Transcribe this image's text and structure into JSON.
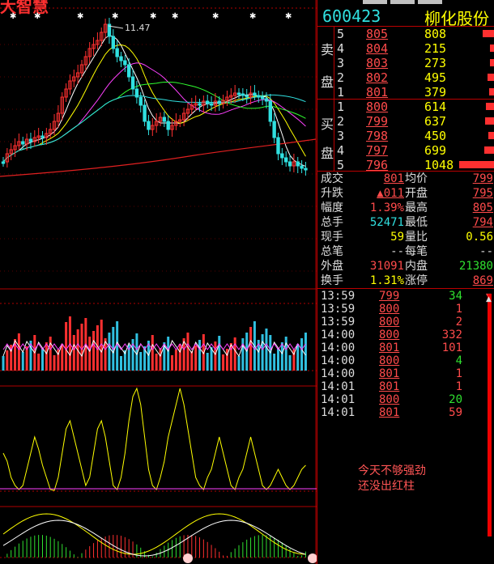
{
  "stock": {
    "code": "600423",
    "name": "柳化股份"
  },
  "window_title_fragment": "大智慧",
  "chart": {
    "high_label": "11.47"
  },
  "order_book": {
    "sell_side_label": [
      "卖",
      "盘"
    ],
    "buy_side_label": [
      "买",
      "盘"
    ],
    "sell": [
      {
        "level": "5",
        "price": "805",
        "volume": "808",
        "bar": 0.35
      },
      {
        "level": "4",
        "price": "804",
        "volume": "215",
        "bar": 0.1
      },
      {
        "level": "3",
        "price": "803",
        "volume": "273",
        "bar": 0.12
      },
      {
        "level": "2",
        "price": "802",
        "volume": "495",
        "bar": 0.2
      },
      {
        "level": "1",
        "price": "801",
        "volume": "379",
        "bar": 0.16
      }
    ],
    "buy": [
      {
        "level": "1",
        "price": "800",
        "volume": "614",
        "bar": 0.26
      },
      {
        "level": "2",
        "price": "799",
        "volume": "637",
        "bar": 0.27
      },
      {
        "level": "3",
        "price": "798",
        "volume": "450",
        "bar": 0.19
      },
      {
        "level": "4",
        "price": "797",
        "volume": "699",
        "bar": 0.3
      },
      {
        "level": "5",
        "price": "796",
        "volume": "1048",
        "bar": 1.0
      }
    ]
  },
  "stats": [
    {
      "l1": "成交",
      "v1": "801",
      "c1": "#ff4b4b",
      "u1": true,
      "l2": "均价",
      "v2": "799",
      "c2": "#ff4b4b",
      "u2": true
    },
    {
      "l1": "升跌",
      "v1": "▲011",
      "c1": "#ff4b4b",
      "u1": true,
      "l2": "开盘",
      "v2": "795",
      "c2": "#ff4b4b",
      "u2": true
    },
    {
      "l1": "幅度",
      "v1": "1.39%",
      "c1": "#ff4b4b",
      "u1": false,
      "l2": "最高",
      "v2": "805",
      "c2": "#ff4b4b",
      "u2": true
    },
    {
      "l1": "总手",
      "v1": "52471",
      "c1": "#30e0e0",
      "u1": false,
      "l2": "最低",
      "v2": "794",
      "c2": "#ff4b4b",
      "u2": true
    },
    {
      "l1": "现手",
      "v1": "59",
      "c1": "#ffff00",
      "u1": false,
      "l2": "量比",
      "v2": "0.56",
      "c2": "#ffff00",
      "u2": false
    },
    {
      "l1": "总笔",
      "v1": "--",
      "c1": "#ddd",
      "u1": false,
      "l2": "每笔",
      "v2": "--",
      "c2": "#ddd",
      "u2": false
    },
    {
      "l1": "外盘",
      "v1": "31091",
      "c1": "#ff4b4b",
      "u1": false,
      "l2": "内盘",
      "v2": "21380",
      "c2": "#30e030",
      "u2": false
    },
    {
      "l1": "换手",
      "v1": "1.31%",
      "c1": "#ffff00",
      "u1": false,
      "l2": "涨停",
      "v2": "869",
      "c2": "#ff4b4b",
      "u2": true
    }
  ],
  "ticks": [
    {
      "time": "13:59",
      "price": "799",
      "vol": "34",
      "color": "#30e030",
      "arrow": "▼"
    },
    {
      "time": "13:59",
      "price": "800",
      "vol": "1",
      "color": "#ff4b4b",
      "arrow": ""
    },
    {
      "time": "13:59",
      "price": "800",
      "vol": "2",
      "color": "#ff4b4b",
      "arrow": ""
    },
    {
      "time": "14:00",
      "price": "800",
      "vol": "332",
      "color": "#ff4b4b",
      "arrow": ""
    },
    {
      "time": "14:00",
      "price": "801",
      "vol": "101",
      "color": "#ff4b4b",
      "arrow": ""
    },
    {
      "time": "14:00",
      "price": "800",
      "vol": "4",
      "color": "#30e030",
      "arrow": ""
    },
    {
      "time": "14:00",
      "price": "801",
      "vol": "1",
      "color": "#ff4b4b",
      "arrow": ""
    },
    {
      "time": "14:01",
      "price": "801",
      "vol": "1",
      "color": "#ff4b4b",
      "arrow": ""
    },
    {
      "time": "14:01",
      "price": "800",
      "vol": "20",
      "color": "#30e030",
      "arrow": ""
    },
    {
      "time": "14:01",
      "price": "801",
      "vol": "59",
      "color": "#ff4b4b",
      "arrow": ""
    }
  ],
  "annotation": {
    "line1": "今天不够强劲",
    "line2": "还没出红柱"
  },
  "colors": {
    "up": "#ff3030",
    "down": "#30e0e0",
    "grid": "#b00000"
  }
}
